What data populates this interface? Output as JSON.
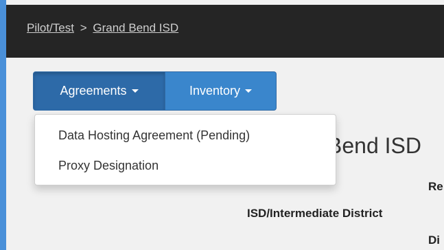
{
  "breadcrumb": {
    "root_link": "Pilot/Test",
    "separator": ">",
    "current_link": "Grand Bend ISD"
  },
  "toolbar": {
    "agreements_label": "Agreements",
    "inventory_label": "Inventory"
  },
  "dropdown": {
    "items": [
      {
        "label": "Data Hosting Agreement (Pending)"
      },
      {
        "label": "Proxy Designation"
      }
    ]
  },
  "page": {
    "title_fragment": "Bend ISD",
    "labels": [
      "Re",
      "ISD/Intermediate District",
      "Di"
    ]
  },
  "colors": {
    "accent": "#4a90d9",
    "topbar": "#252525",
    "button_active": "#2d6aa8",
    "button": "#3a86cc"
  }
}
